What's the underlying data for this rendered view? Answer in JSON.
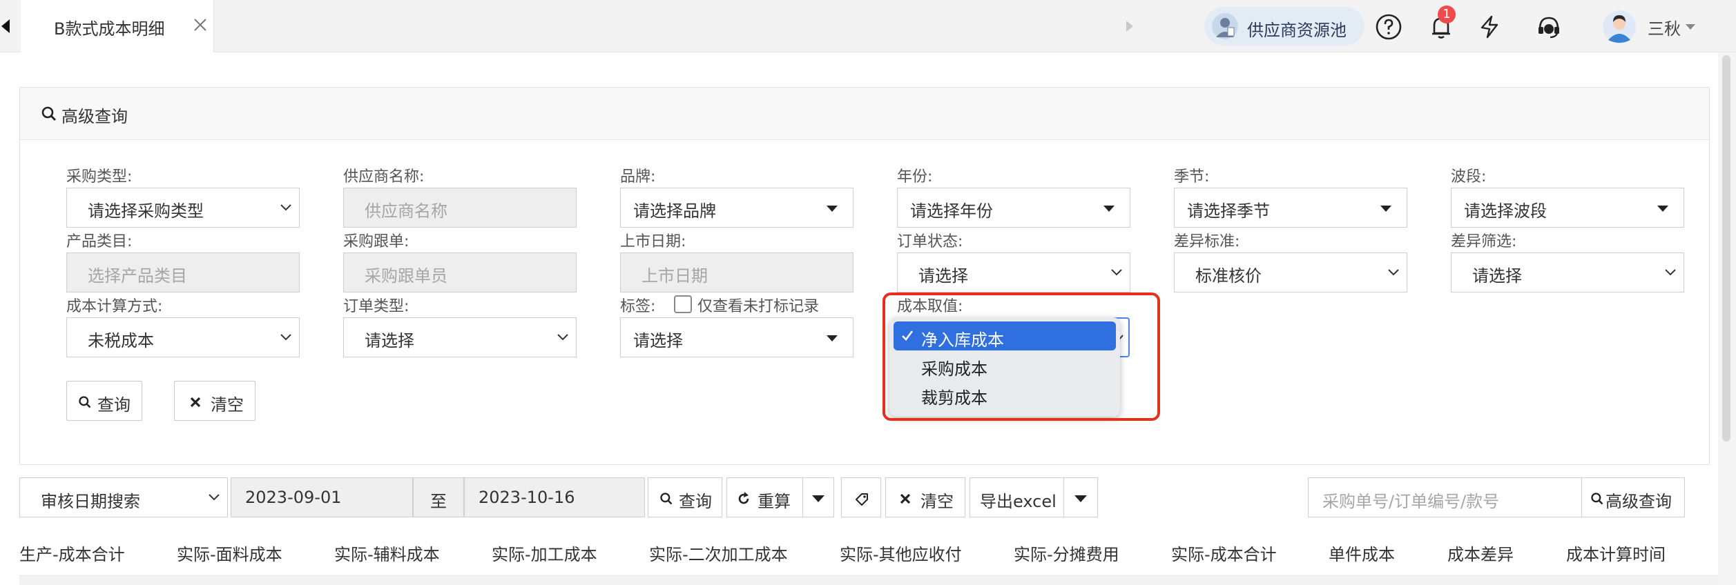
{
  "tab": {
    "title": "B款式成本明细"
  },
  "header": {
    "supplier_pool": "供应商资源池",
    "notification_count": "1",
    "user_name": "三秋"
  },
  "panel": {
    "title": "高级查询"
  },
  "filters": {
    "purchase_type": {
      "label": "采购类型:",
      "value": "请选择采购类型"
    },
    "supplier_name": {
      "label": "供应商名称:",
      "placeholder": "供应商名称"
    },
    "brand": {
      "label": "品牌:",
      "value": "请选择品牌"
    },
    "year": {
      "label": "年份:",
      "value": "请选择年份"
    },
    "season": {
      "label": "季节:",
      "value": "请选择季节"
    },
    "wave": {
      "label": "波段:",
      "value": "请选择波段"
    },
    "product_category": {
      "label": "产品类目:",
      "placeholder": "选择产品类目"
    },
    "purchase_follower": {
      "label": "采购跟单:",
      "placeholder": "采购跟单员"
    },
    "launch_date": {
      "label": "上市日期:",
      "placeholder": "上市日期"
    },
    "order_status": {
      "label": "订单状态:",
      "value": "请选择"
    },
    "diff_standard": {
      "label": "差异标准:",
      "value": "标准核价"
    },
    "diff_filter": {
      "label": "差异筛选:",
      "value": "请选择"
    },
    "cost_method": {
      "label": "成本计算方式:",
      "value": "未税成本"
    },
    "order_type": {
      "label": "订单类型:",
      "value": "请选择"
    },
    "tag": {
      "label": "标签:",
      "checkbox_label": "仅查看未打标记录",
      "value": "请选择"
    },
    "cost_value": {
      "label": "成本取值:",
      "options": [
        "净入库成本",
        "采购成本",
        "裁剪成本"
      ],
      "selected": "净入库成本"
    }
  },
  "panel_buttons": {
    "query": "查询",
    "clear": "清空"
  },
  "toolbar": {
    "date_type": "审核日期搜索",
    "date_from": "2023-09-01",
    "to_label": "至",
    "date_to": "2023-10-16",
    "query": "查询",
    "reset": "重算",
    "clear": "清空",
    "export": "导出excel",
    "search_placeholder": "采购单号/订单编号/款号",
    "advanced": "高级查询"
  },
  "table": {
    "columns": [
      "生产-成本合计",
      "实际-面料成本",
      "实际-辅料成本",
      "实际-加工成本",
      "实际-二次加工成本",
      "实际-其他应收付",
      "实际-分摊费用",
      "实际-成本合计",
      "单件成本",
      "成本差异",
      "成本计算时间"
    ]
  },
  "colors": {
    "accent": "#2f6fe0",
    "highlight": "#e5301c",
    "badge": "#f04b4b"
  }
}
